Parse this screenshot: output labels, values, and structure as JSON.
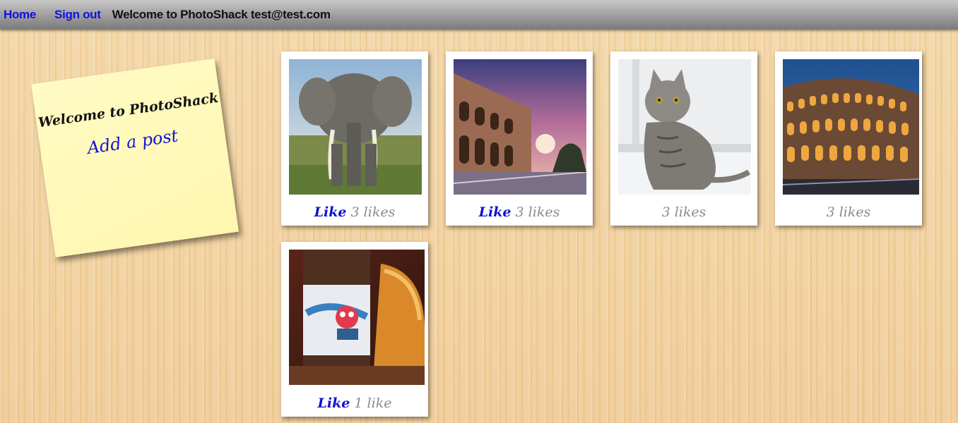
{
  "nav": {
    "home_label": "Home",
    "signout_label": "Sign out",
    "welcome_text": "Welcome to PhotoShack test@test.com"
  },
  "note": {
    "title": "Welcome to PhotoShack",
    "add_post_label": "Add a post"
  },
  "posts": [
    {
      "image": "elephant-photo",
      "like_label": "Like",
      "likes_text": "3 likes"
    },
    {
      "image": "arena-sunset-photo",
      "like_label": "Like",
      "likes_text": "3 likes"
    },
    {
      "image": "cat-photo",
      "like_label": "",
      "likes_text": "3 likes"
    },
    {
      "image": "colosseum-night-photo",
      "like_label": "",
      "likes_text": "3 likes"
    },
    {
      "image": "beer-bottle-photo",
      "like_label": "Like",
      "likes_text": "1 like"
    }
  ],
  "colors": {
    "link": "#1010d0",
    "note_bg": "#fff8b8",
    "likes_grey": "#8a8a8a"
  }
}
